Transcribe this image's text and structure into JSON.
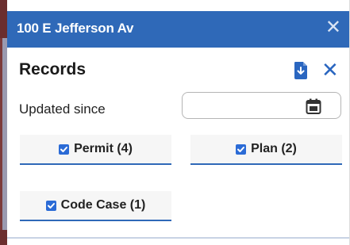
{
  "panel": {
    "title": "100 E Jefferson Av",
    "close_label": "✕"
  },
  "records": {
    "heading": "Records",
    "close_label": "✕",
    "export_icon": "export-down-icon",
    "updated_since_label": "Updated since",
    "updated_since_value": "",
    "updated_since_placeholder": "",
    "calendar_icon": "calendar-icon"
  },
  "filters": [
    {
      "label": "Permit (4)",
      "checked": true
    },
    {
      "label": "Plan (2)",
      "checked": true
    },
    {
      "label": "Code Case (1)",
      "checked": true
    }
  ],
  "colors": {
    "header_bg": "#2f69b8",
    "accent": "#2b6bd6",
    "checkbox": "#2b6bd6"
  }
}
